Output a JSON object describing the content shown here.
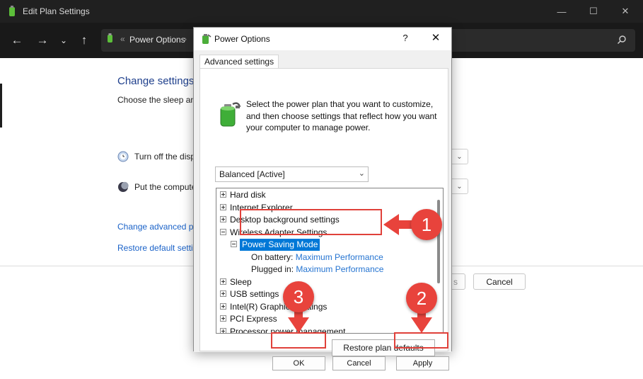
{
  "background_window": {
    "title": "Edit Plan Settings",
    "breadcrumb": "Power Options",
    "heading": "Change settings",
    "subtitle": "Choose the sleep an",
    "row_display": "Turn off the disp",
    "row_sleep": "Put the compute",
    "link_advanced": "Change advanced p",
    "link_restore": "Restore default setti",
    "save_partial": "s",
    "cancel": "Cancel"
  },
  "dialog": {
    "title": "Power Options",
    "help": "?",
    "close": "✕",
    "tab": "Advanced settings",
    "intro": "Select the power plan that you want to customize, and then choose settings that reflect how you want your computer to manage power.",
    "plan_selected": "Balanced [Active]",
    "tree": [
      {
        "label": "Hard disk",
        "state": "collapsed"
      },
      {
        "label": "Internet Explorer",
        "state": "collapsed"
      },
      {
        "label": "Desktop background settings",
        "state": "collapsed"
      },
      {
        "label": "Wireless Adapter Settings",
        "state": "expanded"
      },
      {
        "label": "Power Saving Mode",
        "state": "expanded",
        "selected": true
      },
      {
        "label": "On battery:",
        "value": "Maximum Performance"
      },
      {
        "label": "Plugged in:",
        "value": "Maximum Performance"
      },
      {
        "label": "Sleep",
        "state": "collapsed"
      },
      {
        "label": "USB settings",
        "state": "collapsed"
      },
      {
        "label": "Intel(R) Graphics Settings",
        "state": "collapsed"
      },
      {
        "label": "PCI Express",
        "state": "collapsed"
      },
      {
        "label": "Processor power management",
        "state": "collapsed"
      }
    ],
    "restore_button": "Restore plan defaults",
    "ok_button": "OK",
    "cancel_button": "Cancel",
    "apply_button": "Apply"
  },
  "callouts": [
    "1",
    "2",
    "3"
  ],
  "colors": {
    "accent": "#0078d7",
    "link": "#2574d1",
    "callout": "#e8433c",
    "titlebar": "#202020"
  }
}
